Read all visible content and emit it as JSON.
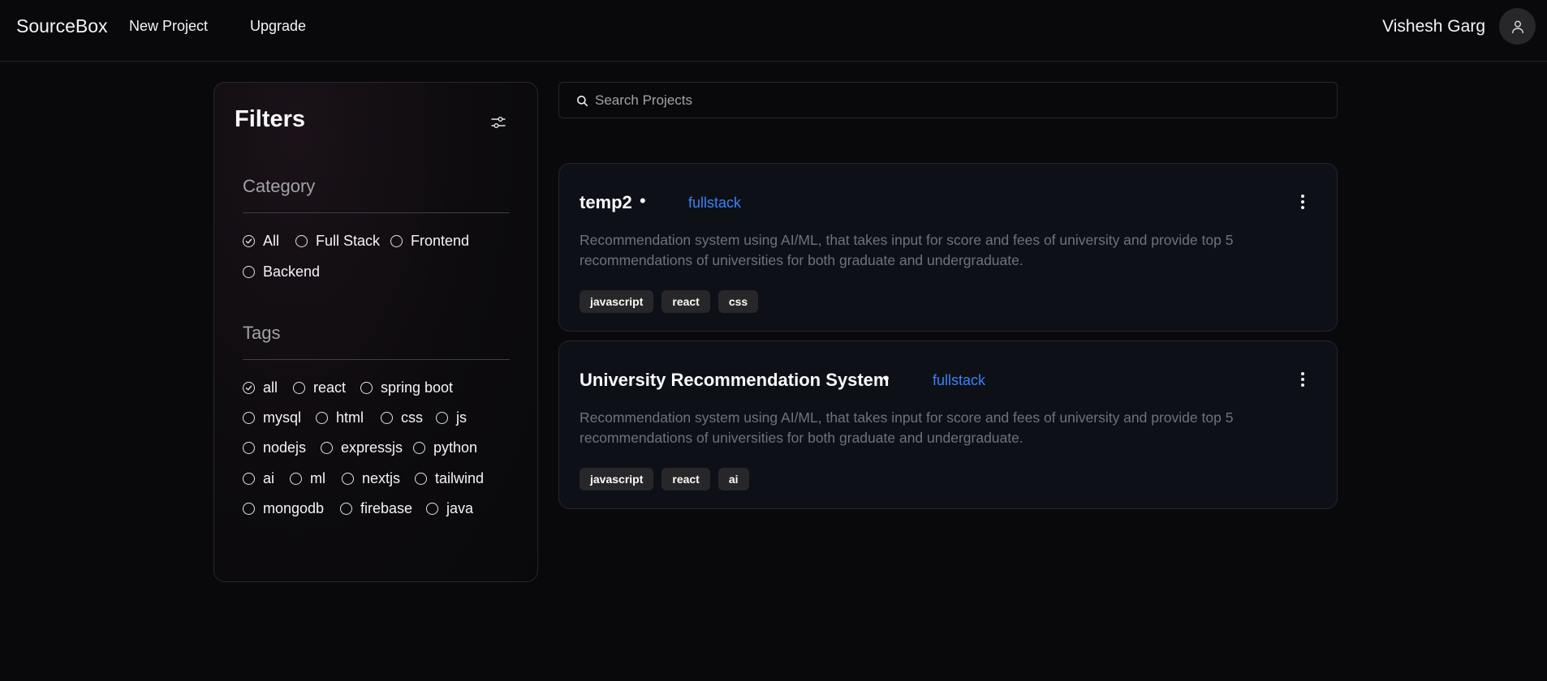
{
  "header": {
    "brand": "SourceBox",
    "nav": {
      "new_project": "New Project",
      "upgrade": "Upgrade"
    },
    "user_name": "Vishesh Garg",
    "avatar_icon": "user-icon"
  },
  "filters": {
    "title": "Filters",
    "settings_icon": "sliders-icon",
    "category": {
      "title": "Category",
      "options": [
        {
          "label": "All",
          "checked": true
        },
        {
          "label": "Full Stack",
          "checked": false
        },
        {
          "label": "Frontend",
          "checked": false
        },
        {
          "label": "Backend",
          "checked": false
        }
      ]
    },
    "tags": {
      "title": "Tags",
      "options": [
        {
          "label": "all",
          "checked": true
        },
        {
          "label": "react",
          "checked": false
        },
        {
          "label": "spring boot",
          "checked": false
        },
        {
          "label": "mysql",
          "checked": false
        },
        {
          "label": "html",
          "checked": false
        },
        {
          "label": "css",
          "checked": false
        },
        {
          "label": "js",
          "checked": false
        },
        {
          "label": "nodejs",
          "checked": false
        },
        {
          "label": "expressjs",
          "checked": false
        },
        {
          "label": "python",
          "checked": false
        },
        {
          "label": "ai",
          "checked": false
        },
        {
          "label": "ml",
          "checked": false
        },
        {
          "label": "nextjs",
          "checked": false
        },
        {
          "label": "tailwind",
          "checked": false
        },
        {
          "label": "mongodb",
          "checked": false
        },
        {
          "label": "firebase",
          "checked": false
        },
        {
          "label": "java",
          "checked": false
        }
      ]
    }
  },
  "search": {
    "placeholder": "Search Projects",
    "value": ""
  },
  "projects": [
    {
      "title": "temp2",
      "separator": "•",
      "category": "fullstack",
      "description": "Recommendation system using AI/ML, that takes input for score and fees of university and provide top 5 recommendations of universities for both graduate and undergraduate.",
      "tags": [
        "javascript",
        "react",
        "css"
      ]
    },
    {
      "title": "University Recommendation System",
      "separator": "•",
      "category": "fullstack",
      "description": "Recommendation system using AI/ML, that takes input for score and fees of university and provide top 5 recommendations of universities for both graduate and undergraduate.",
      "tags": [
        "javascript",
        "react",
        "ai"
      ]
    }
  ],
  "colors": {
    "background": "#09090b",
    "card": "#0d1017",
    "border": "#27272a",
    "accent": "#3b82f6",
    "muted_text": "#71717a"
  }
}
